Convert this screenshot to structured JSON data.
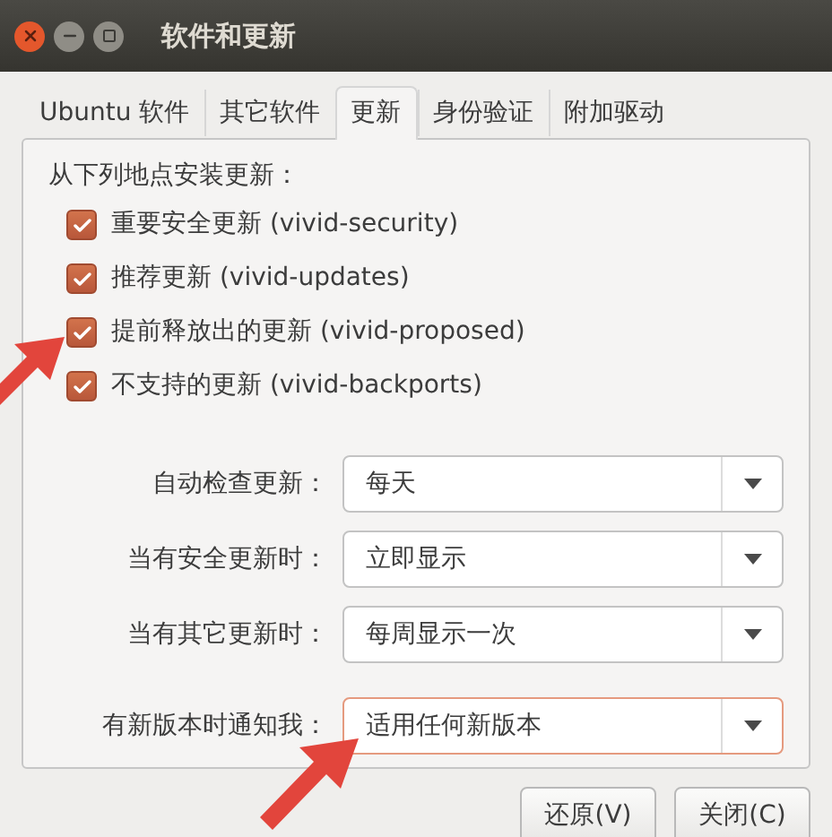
{
  "window": {
    "title": "软件和更新"
  },
  "tabs": [
    {
      "label": "Ubuntu 软件",
      "selected": false
    },
    {
      "label": "其它软件",
      "selected": false
    },
    {
      "label": "更新",
      "selected": true
    },
    {
      "label": "身份验证",
      "selected": false
    },
    {
      "label": "附加驱动",
      "selected": false
    }
  ],
  "sources": {
    "heading": "从下列地点安装更新：",
    "items": [
      {
        "label": "重要安全更新 (vivid-security)",
        "checked": true
      },
      {
        "label": "推荐更新 (vivid-updates)",
        "checked": true
      },
      {
        "label": "提前释放出的更新 (vivid-proposed)",
        "checked": true
      },
      {
        "label": "不支持的更新 (vivid-backports)",
        "checked": true
      }
    ]
  },
  "update_settings": [
    {
      "label": "自动检查更新：",
      "value": "每天",
      "focused": false
    },
    {
      "label": "当有安全更新时：",
      "value": "立即显示",
      "focused": false
    },
    {
      "label": "当有其它更新时：",
      "value": "每周显示一次",
      "focused": false
    }
  ],
  "release_notify": {
    "label": "有新版本时通知我：",
    "value": "适用任何新版本",
    "focused": true
  },
  "buttons": [
    "还原(V)",
    "关闭(C)"
  ]
}
